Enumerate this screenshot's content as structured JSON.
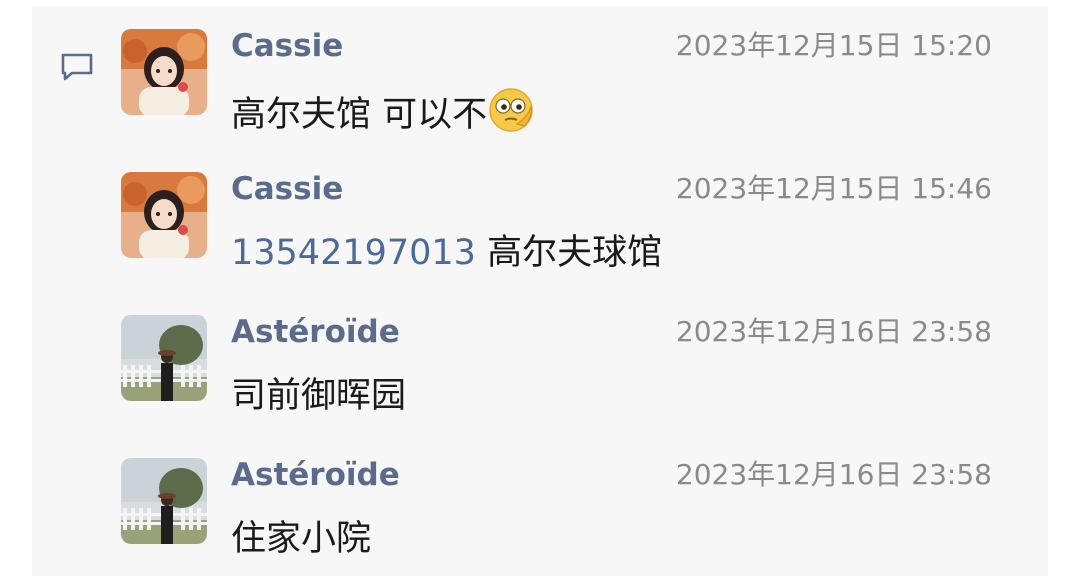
{
  "messages": [
    {
      "sender": "Cassie",
      "time": "2023年12月15日 15:20",
      "text": "高尔夫馆 可以不",
      "emoji": "thinking-face-emoji",
      "avatar": "cassie-avatar"
    },
    {
      "sender": "Cassie",
      "time": "2023年12月15日 15:46",
      "phone": "13542197013",
      "text": " 高尔夫球馆",
      "avatar": "cassie-avatar"
    },
    {
      "sender": "Astéroïde",
      "time": "2023年12月16日 23:58",
      "text": "司前御晖园",
      "avatar": "asteroide-avatar"
    },
    {
      "sender": "Astéroïde",
      "time": "2023年12月16日 23:58",
      "text": "住家小院",
      "avatar": "asteroide-avatar"
    }
  ],
  "icons": {
    "chat": "chat-bubble-icon"
  },
  "colors": {
    "sender": "#5a6b8c",
    "link": "#4b6a9b",
    "time": "#8a8a8a",
    "background": "#f7f7f7"
  }
}
